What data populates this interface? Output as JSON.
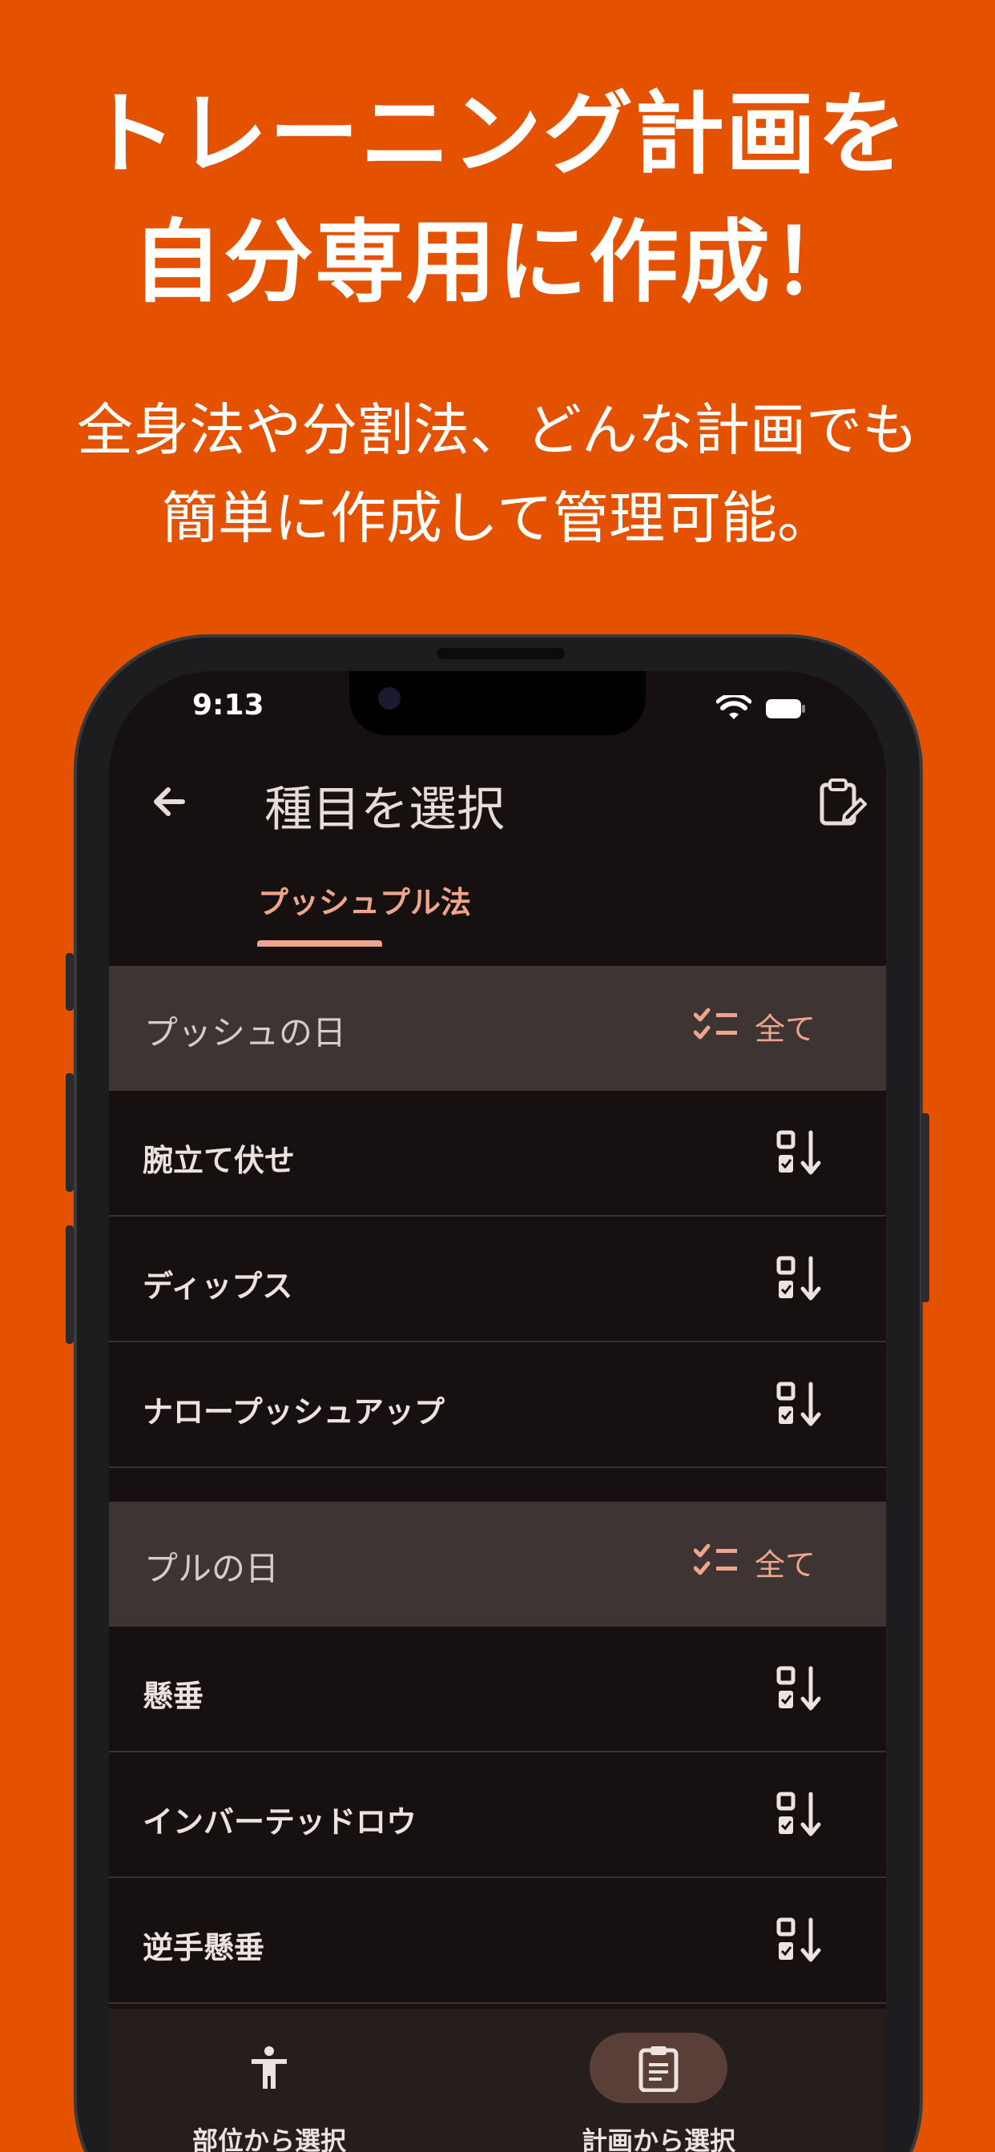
{
  "promo": {
    "headline_line1": "トレーニング計画を",
    "headline_line2": "自分専用に作成！",
    "sub_line1": "全身法や分割法、どんな計画でも",
    "sub_line2": "簡単に作成して管理可能。"
  },
  "status_bar": {
    "time": "9:13"
  },
  "app_bar": {
    "title": "種目を選択"
  },
  "tabs": [
    {
      "label": "プッシュプル法",
      "selected": true
    }
  ],
  "groups": [
    {
      "title": "プッシュの日",
      "select_all_label": "全て",
      "items": [
        {
          "label": "腕立て伏せ"
        },
        {
          "label": "ディップス"
        },
        {
          "label": "ナロープッシュアップ"
        }
      ]
    },
    {
      "title": "プルの日",
      "select_all_label": "全て",
      "items": [
        {
          "label": "懸垂"
        },
        {
          "label": "インバーテッドロウ"
        },
        {
          "label": "逆手懸垂"
        }
      ]
    }
  ],
  "bottom_nav": [
    {
      "label": "部位から選択",
      "icon": "person-icon",
      "active": false
    },
    {
      "label": "計画から選択",
      "icon": "clipboard-icon",
      "active": true
    }
  ],
  "colors": {
    "background": "#e45200",
    "accent": "#f0a48c",
    "screen": "#161010",
    "group_header": "#3e3433"
  }
}
